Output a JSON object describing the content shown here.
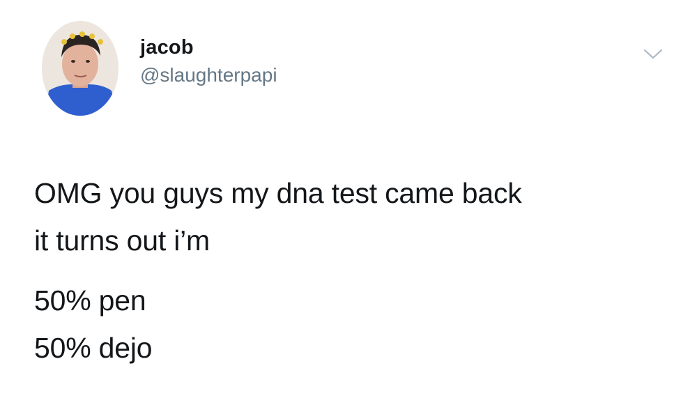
{
  "tweet": {
    "author": {
      "display_name": "jacob",
      "handle": "@slaughterpapi"
    },
    "menu_icon": "chevron-down-icon",
    "text_lines": [
      "OMG you guys my dna test came back",
      "it turns out i’m"
    ],
    "result_lines": [
      "50% pen",
      "50% dejo"
    ]
  },
  "colors": {
    "text": "#14171a",
    "secondary": "#657786",
    "chevron": "#aab8c2",
    "background": "#ffffff"
  }
}
